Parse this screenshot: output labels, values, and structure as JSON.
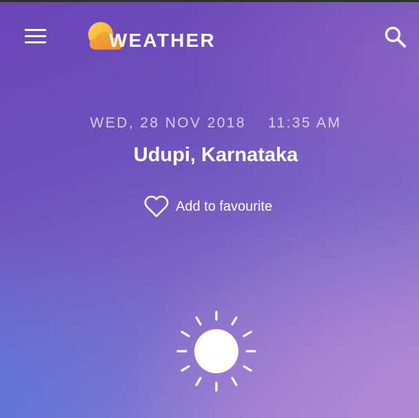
{
  "header": {
    "logo_text": "WEATHER",
    "menu_icon": "hamburger-menu-icon",
    "search_icon": "search-icon",
    "logo_colors": [
      "#f9c23c",
      "#f59a2e"
    ]
  },
  "main": {
    "date": "WED, 28 NOV 2018",
    "time": "11:35 AM",
    "location": "Udupi, Karnataka",
    "favourite_label": "Add to favourite",
    "favourite_icon": "heart-outline-icon",
    "weather_icon": "sun-icon"
  },
  "colors": {
    "gradient_top": "#6a45b6",
    "gradient_bottom_left": "#5578dc",
    "gradient_bottom_right": "#b98cd7",
    "text": "#ffffff"
  }
}
